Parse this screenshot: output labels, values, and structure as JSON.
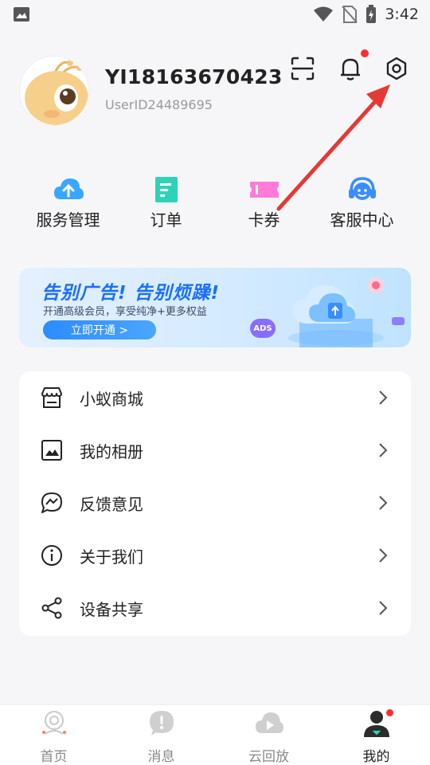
{
  "status_bar": {
    "time": "3:42",
    "icons": [
      "image-icon",
      "wifi-icon",
      "no-sim-icon",
      "battery-charging-icon"
    ]
  },
  "profile": {
    "username": "YI18163670423",
    "user_id": "UserID24489695",
    "header_icons": [
      "scan-icon",
      "bell-icon",
      "settings-icon"
    ]
  },
  "quick_actions": [
    {
      "label": "服务管理",
      "icon": "cloud-upload-icon",
      "color": "#38a7ff"
    },
    {
      "label": "订单",
      "icon": "order-doc-icon",
      "color": "#2dd3b8"
    },
    {
      "label": "卡券",
      "icon": "coupon-icon",
      "color": "#ff7ad9"
    },
    {
      "label": "客服中心",
      "icon": "customer-service-icon",
      "color": "#3a8dff"
    }
  ],
  "banner": {
    "title": "告别广告! 告别烦躁!",
    "subtitle": "开通高级会员，享受纯净+更多权益",
    "button": "立即开通 >",
    "badge": "ADS"
  },
  "menu": [
    {
      "label": "小蚁商城",
      "icon": "store-icon"
    },
    {
      "label": "我的相册",
      "icon": "album-icon"
    },
    {
      "label": "反馈意见",
      "icon": "feedback-icon"
    },
    {
      "label": "关于我们",
      "icon": "info-icon"
    },
    {
      "label": "设备共享",
      "icon": "share-icon"
    }
  ],
  "bottom_nav": [
    {
      "label": "首页",
      "icon": "home-camera-icon",
      "active": false
    },
    {
      "label": "消息",
      "icon": "message-icon",
      "active": false
    },
    {
      "label": "云回放",
      "icon": "cloud-playback-icon",
      "active": false
    },
    {
      "label": "我的",
      "icon": "me-icon",
      "active": true
    }
  ],
  "colors": {
    "accent": "#1a6fff",
    "badge_red": "#ff2d2d",
    "annotation_arrow": "#e53935"
  }
}
